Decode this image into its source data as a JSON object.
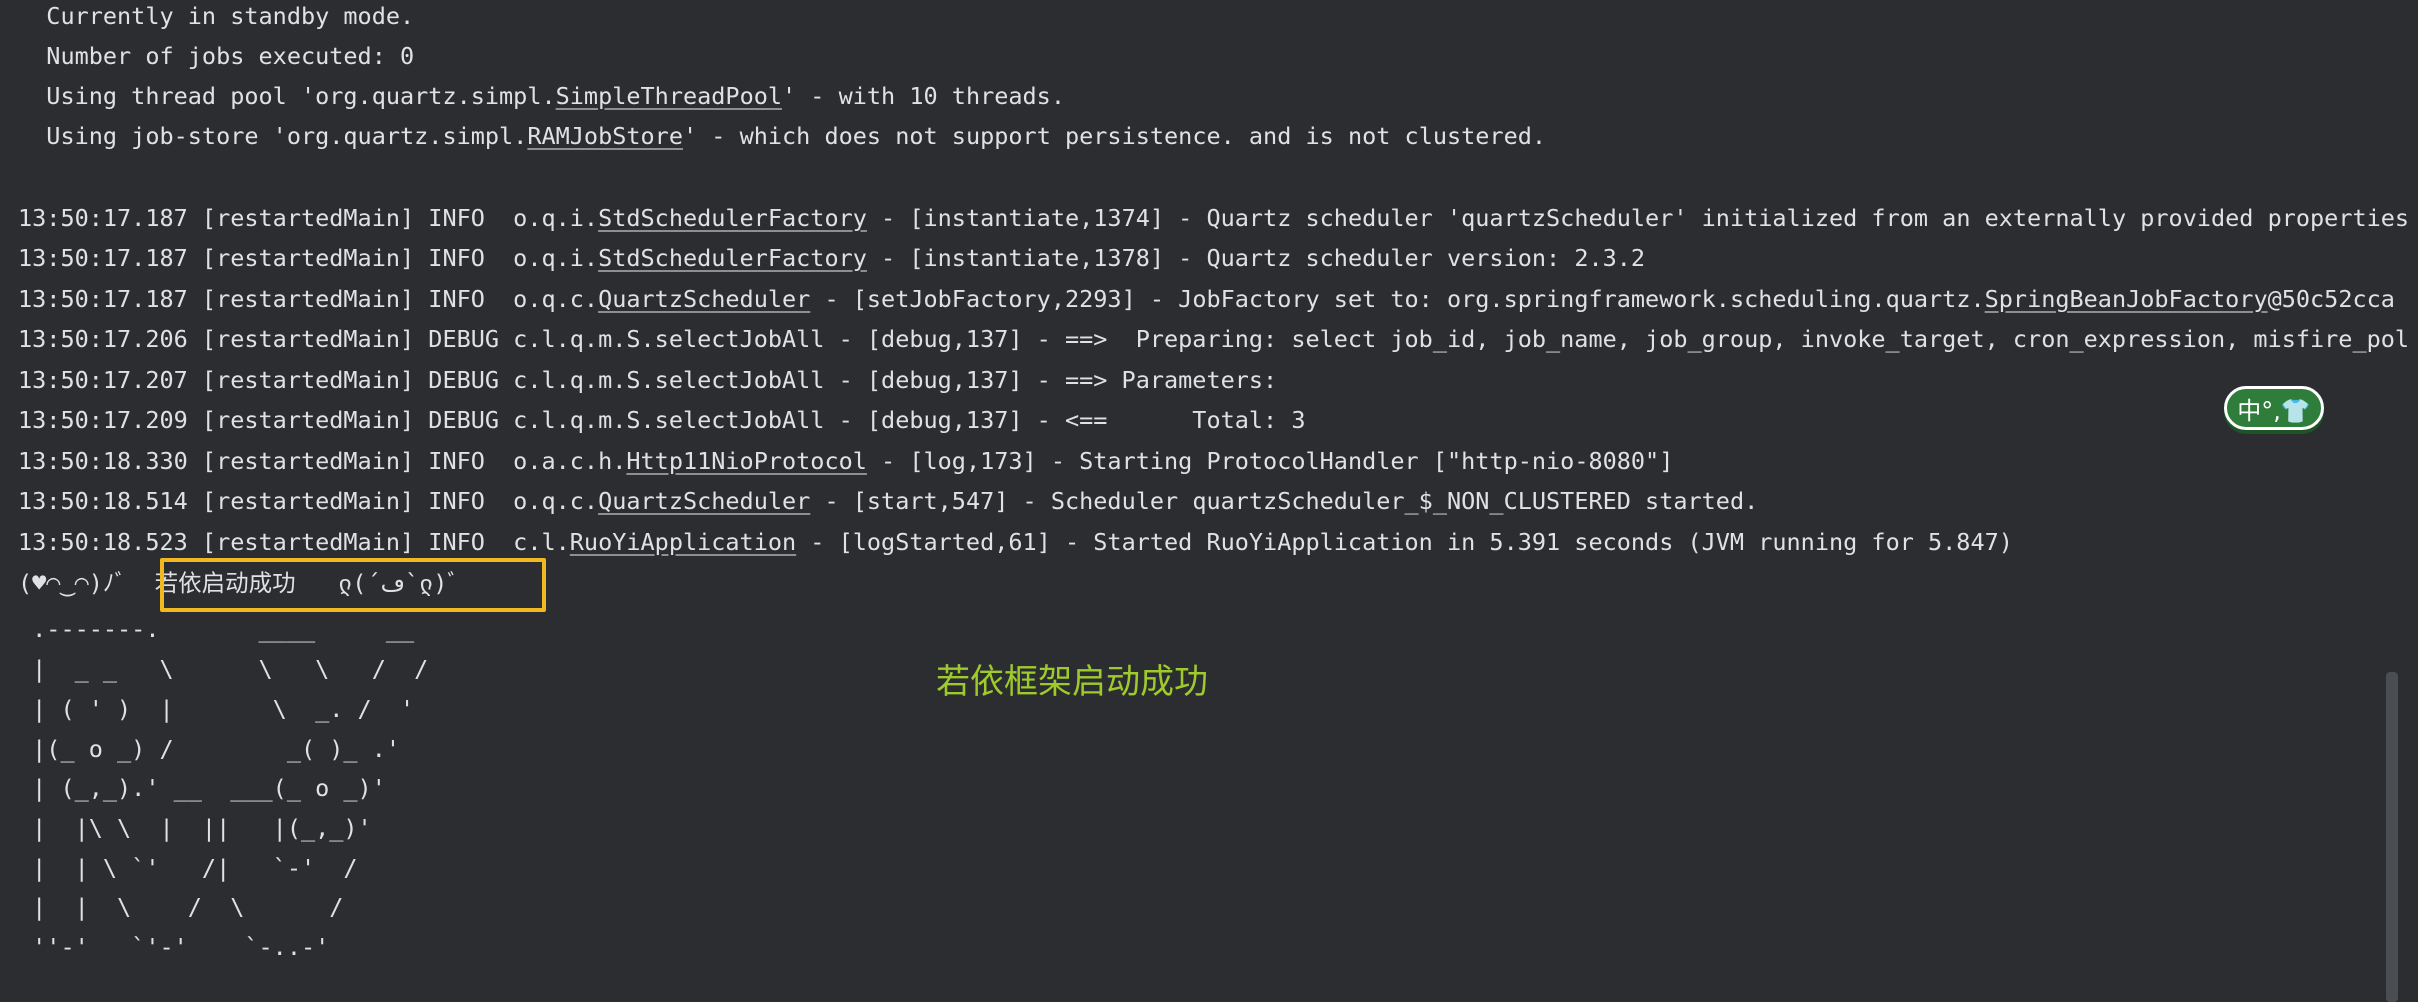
{
  "log": {
    "line_standby": "  Currently in standby mode.",
    "line_jobs": "  Number of jobs executed: 0",
    "line_threadpool_a": "  Using thread pool 'org.quartz.simpl.",
    "line_threadpool_link": "SimpleThreadPool",
    "line_threadpool_b": "' - with 10 threads.",
    "line_jobstore_a": "  Using job-store 'org.quartz.simpl.",
    "line_jobstore_link": "RAMJobStore",
    "line_jobstore_b": "' - which does not support persistence. and is not clustered.",
    "e1_a": "13:50:17.187 [restartedMain] INFO  o.q.i.",
    "e1_link": "StdSchedulerFactory",
    "e1_b": " - [instantiate,1374] - Quartz scheduler 'quartzScheduler' initialized from an externally provided properties",
    "e2_a": "13:50:17.187 [restartedMain] INFO  o.q.i.",
    "e2_link": "StdSchedulerFactory",
    "e2_b": " - [instantiate,1378] - Quartz scheduler version: 2.3.2",
    "e3_a": "13:50:17.187 [restartedMain] INFO  o.q.c.",
    "e3_link": "QuartzScheduler",
    "e3_b": " - [setJobFactory,2293] - JobFactory set to: org.springframework.scheduling.quartz.",
    "e3_link2": "SpringBeanJobFactory",
    "e3_c": "@50c52cca",
    "e4": "13:50:17.206 [restartedMain] DEBUG c.l.q.m.S.selectJobAll - [debug,137] - ==>  Preparing: select job_id, job_name, job_group, invoke_target, cron_expression, misfire_pol",
    "e5": "13:50:17.207 [restartedMain] DEBUG c.l.q.m.S.selectJobAll - [debug,137] - ==> Parameters: ",
    "e6": "13:50:17.209 [restartedMain] DEBUG c.l.q.m.S.selectJobAll - [debug,137] - <==      Total: 3",
    "e7_a": "13:50:18.330 [restartedMain] INFO  o.a.c.h.",
    "e7_link": "Http11NioProtocol",
    "e7_b": " - [log,173] - Starting ProtocolHandler [\"http-nio-8080\"]",
    "e8_a": "13:50:18.514 [restartedMain] INFO  o.q.c.",
    "e8_link": "QuartzScheduler",
    "e8_b": " - [start,547] - Scheduler quartzScheduler_$_NON_CLUSTERED started.",
    "e9_a": "13:50:18.523 [restartedMain] INFO  c.l.",
    "e9_link": "RuoYiApplication",
    "e9_b": " - [logStarted,61] - Started RuoYiApplication in 5.391 seconds (JVM running for 5.847)",
    "success_line": "(♥◠‿◠)ﾉﾞ  若依启动成功   ლ(´ڡ`ლ)ﾞ",
    "ascii": [
      " .-------.       ____     __",
      " |  _ _   \\      \\   \\   /  /",
      " | ( ' )  |       \\  _. /  '",
      " |(_ o _) /        _( )_ .'",
      " | (_,_).' __  ___(_ o _)'",
      " |  |\\ \\  |  ||   |(_,_)'",
      " |  | \\ `'   /|   `-'  /",
      " |  |  \\    /  \\      /",
      " ''-'   `'-'    `-..-'"
    ]
  },
  "annotation": {
    "text": "若依框架启动成功",
    "color": "#9ecb2b",
    "box_color": "#f2b81f"
  },
  "ime_badge": {
    "text": "中°,👕"
  }
}
